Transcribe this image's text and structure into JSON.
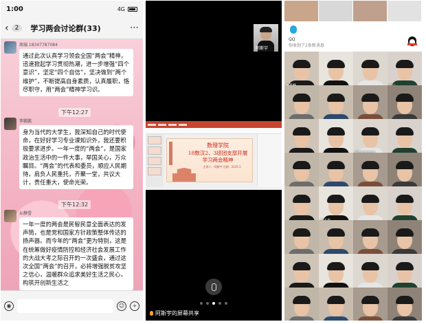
{
  "wechat": {
    "status_time": "1:00",
    "signal": "4G",
    "unread_count": "2",
    "chat_title": "学习两会讨论群(33)",
    "messages": [
      {
        "sender": "周瑞 18347787084",
        "text": "通过此次认真学习领会全国“两会”精神，迅速掀起学习贯彻热潮，进一步增强“四个意识”，坚定“四个自信”，坚决做到“两个维护”，不断提高自身素质，认真履职，恪尽职守，用“两会”精神学习识。"
      },
      {
        "sender": "李鹏鹏",
        "text": "身为当代的大学生，我深知自己的时代使命，在好好学习专业课知识外，我还要积极要求进步。一年一度的“两会”，是国家政治生活中的一件大事，举国关心，万众瞩目。“两会”的代表和委员，顺应人民期待，肩负人民重托，齐聚一堂，共议大计，责任重大，使命光荣。"
      },
      {
        "sender": "从静雪",
        "text": "一年一度的两会是民智民意全面表达的发声筒，也是党和国家方针政策整体传达的扬声器。而今年的“两会”更为特别，这是在统筹做好疫情防控和经济社会发展工作的大战大考之际召开的一次盛会，通过这次全国“两会”的召开，必将增强脱贫攻坚之信心，温暖群众追求美好生活之民心，构筑开创新生活之"
      }
    ],
    "timestamps": [
      "下午12:27",
      "下午12:32"
    ]
  },
  "screenshare": {
    "self_name": "阿斯宇",
    "slide_title_1": "数理学院",
    "slide_title_2": "18数汉2、3班团支部开展",
    "slide_title_3": "学习两会精神",
    "slide_sub": "主讲人：阿斯宇 日期：2020.5",
    "caption": "阿斯宇的屏幕共享"
  },
  "qq": {
    "label": "QQ",
    "sublabel": "你收到了2条新消息",
    "participants": [
      "李嘉畅",
      "",
      "",
      "金山",
      "",
      "",
      "",
      "",
      "",
      "",
      "芙蓉桃桃桃桃",
      "",
      "",
      "",
      "",
      "",
      "",
      "文子龙",
      "",
      "",
      "",
      "",
      "",
      "",
      "",
      "",
      "",
      "",
      "",
      "",
      "",
      ""
    ]
  }
}
